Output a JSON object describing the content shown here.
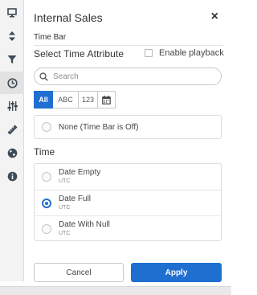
{
  "rail": {
    "icons": [
      "monitor-icon",
      "sort-arrows-icon",
      "filter-icon",
      "clock-icon",
      "sliders-icon",
      "ruler-icon",
      "globe-icon",
      "info-icon"
    ],
    "active_icon": "clock-icon",
    "icon_color": "#3d4a57"
  },
  "panel": {
    "title": "Internal Sales",
    "close_glyph": "×",
    "layer_name": "Time Bar",
    "select_label": "Select Time Attribute",
    "playback_label": "Enable playback",
    "playback_checked": false,
    "search_placeholder": "Search",
    "filters": [
      {
        "label": "All",
        "selected": true
      },
      {
        "label": "ABC",
        "selected": false
      },
      {
        "label": "123",
        "selected": false
      },
      {
        "icon": "calendar-icon",
        "selected": false
      }
    ],
    "none_option": "None (Time Bar is Off)",
    "time_label": "Time",
    "time_options": [
      {
        "name": "Date Empty",
        "sub": "UTC",
        "selected": false
      },
      {
        "name": "Date Full",
        "sub": "UTC",
        "selected": true
      },
      {
        "name": "Date With Null",
        "sub": "UTC",
        "selected": false
      }
    ],
    "cancel_label": "Cancel",
    "apply_label": "Apply",
    "accent_color": "#1f6fd1"
  }
}
